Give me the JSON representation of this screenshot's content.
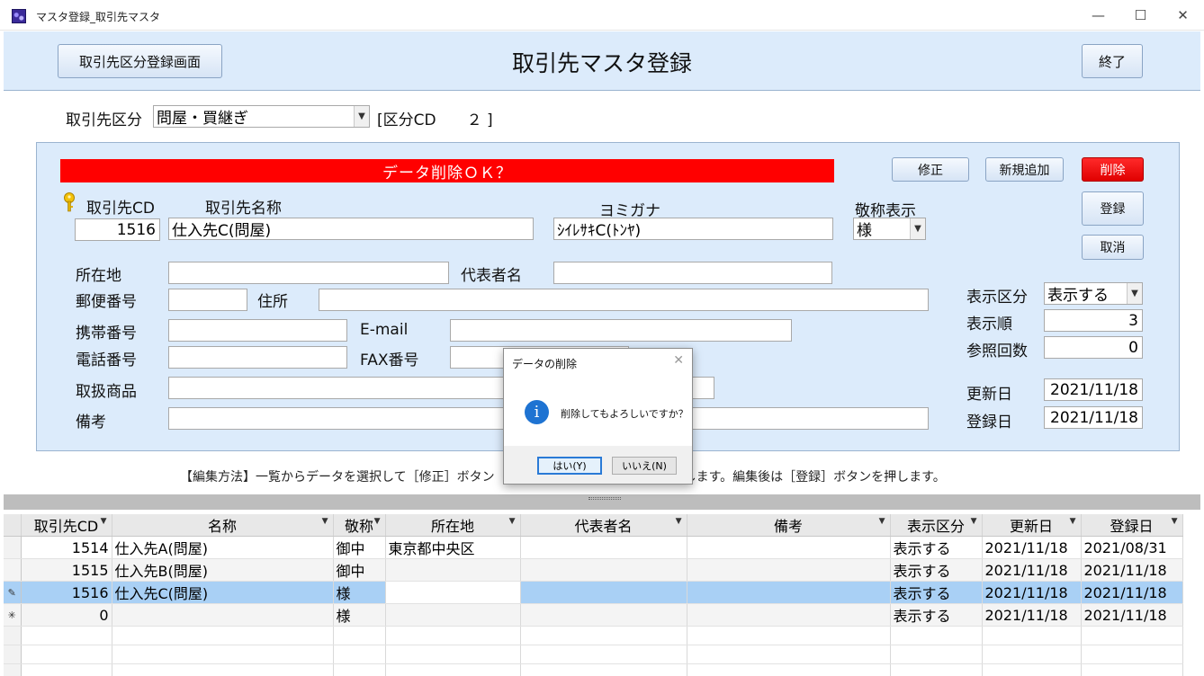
{
  "window": {
    "title": "マスタ登録_取引先マスタ",
    "minimize": "—",
    "maximize": "☐",
    "close": "✕"
  },
  "header": {
    "category_button": "取引先区分登録画面",
    "title": "取引先マスタ登録",
    "exit_button": "終了"
  },
  "category": {
    "label": "取引先区分",
    "value": "問屋・買継ぎ",
    "code_text": "[区分CD　　２ ]"
  },
  "panel": {
    "banner": "データ削除ＯＫ？",
    "buttons": {
      "edit": "修正",
      "add_new": "新規追加",
      "delete": "削除",
      "register": "登録",
      "cancel": "取消"
    },
    "labels": {
      "code": "取引先CD",
      "name": "取引先名称",
      "kana": "ヨミガナ",
      "honorific": "敬称表示",
      "location": "所在地",
      "representative": "代表者名",
      "postal": "郵便番号",
      "address": "住所",
      "mobile": "携帯番号",
      "email": "E-mail",
      "phone": "電話番号",
      "fax": "FAX番号",
      "products": "取扱商品",
      "remarks": "備考",
      "display_category": "表示区分",
      "display_order": "表示順",
      "ref_count": "参照回数",
      "updated": "更新日",
      "registered": "登録日"
    },
    "values": {
      "code": "1516",
      "name": "仕入先C(問屋)",
      "kana": "ｼｲﾚｻｷC(ﾄﾝﾔ)",
      "honorific": "様",
      "location": "",
      "representative": "",
      "postal": "",
      "address": "",
      "mobile": "",
      "email": "",
      "phone": "",
      "fax": "",
      "products": "",
      "remarks": "",
      "display_category": "表示する",
      "display_order": "3",
      "ref_count": "0",
      "updated": "2021/11/18",
      "registered": "2021/11/18"
    }
  },
  "instruction": "【編集方法】一覧からデータを選択して［修正］ボタン　　　　　　　　　　　　ンを押します。編集後は［登録］ボタンを押します。",
  "grid": {
    "columns": [
      "取引先CD",
      "名称",
      "敬称",
      "所在地",
      "代表者名",
      "備考",
      "表示区分",
      "更新日",
      "登録日"
    ],
    "rows": [
      {
        "marker": "",
        "cells": [
          "1514",
          "仕入先A(問屋)",
          "御中",
          "東京都中央区",
          "",
          "",
          "表示する",
          "2021/11/18",
          "2021/08/31"
        ]
      },
      {
        "marker": "",
        "cells": [
          "1515",
          "仕入先B(問屋)",
          "御中",
          "",
          "",
          "",
          "表示する",
          "2021/11/18",
          "2021/11/18"
        ]
      },
      {
        "marker": "✎",
        "cells": [
          "1516",
          "仕入先C(問屋)",
          "様",
          "",
          "",
          "",
          "表示する",
          "2021/11/18",
          "2021/11/18"
        ]
      },
      {
        "marker": "✳",
        "cells": [
          "0",
          "",
          "様",
          "",
          "",
          "",
          "表示する",
          "2021/11/18",
          "2021/11/18"
        ]
      }
    ]
  },
  "dialog": {
    "title": "データの削除",
    "message": "削除してもよろしいですか？",
    "yes": "はい(Y)",
    "no": "いいえ(N)",
    "close": "✕",
    "icon": "i"
  }
}
